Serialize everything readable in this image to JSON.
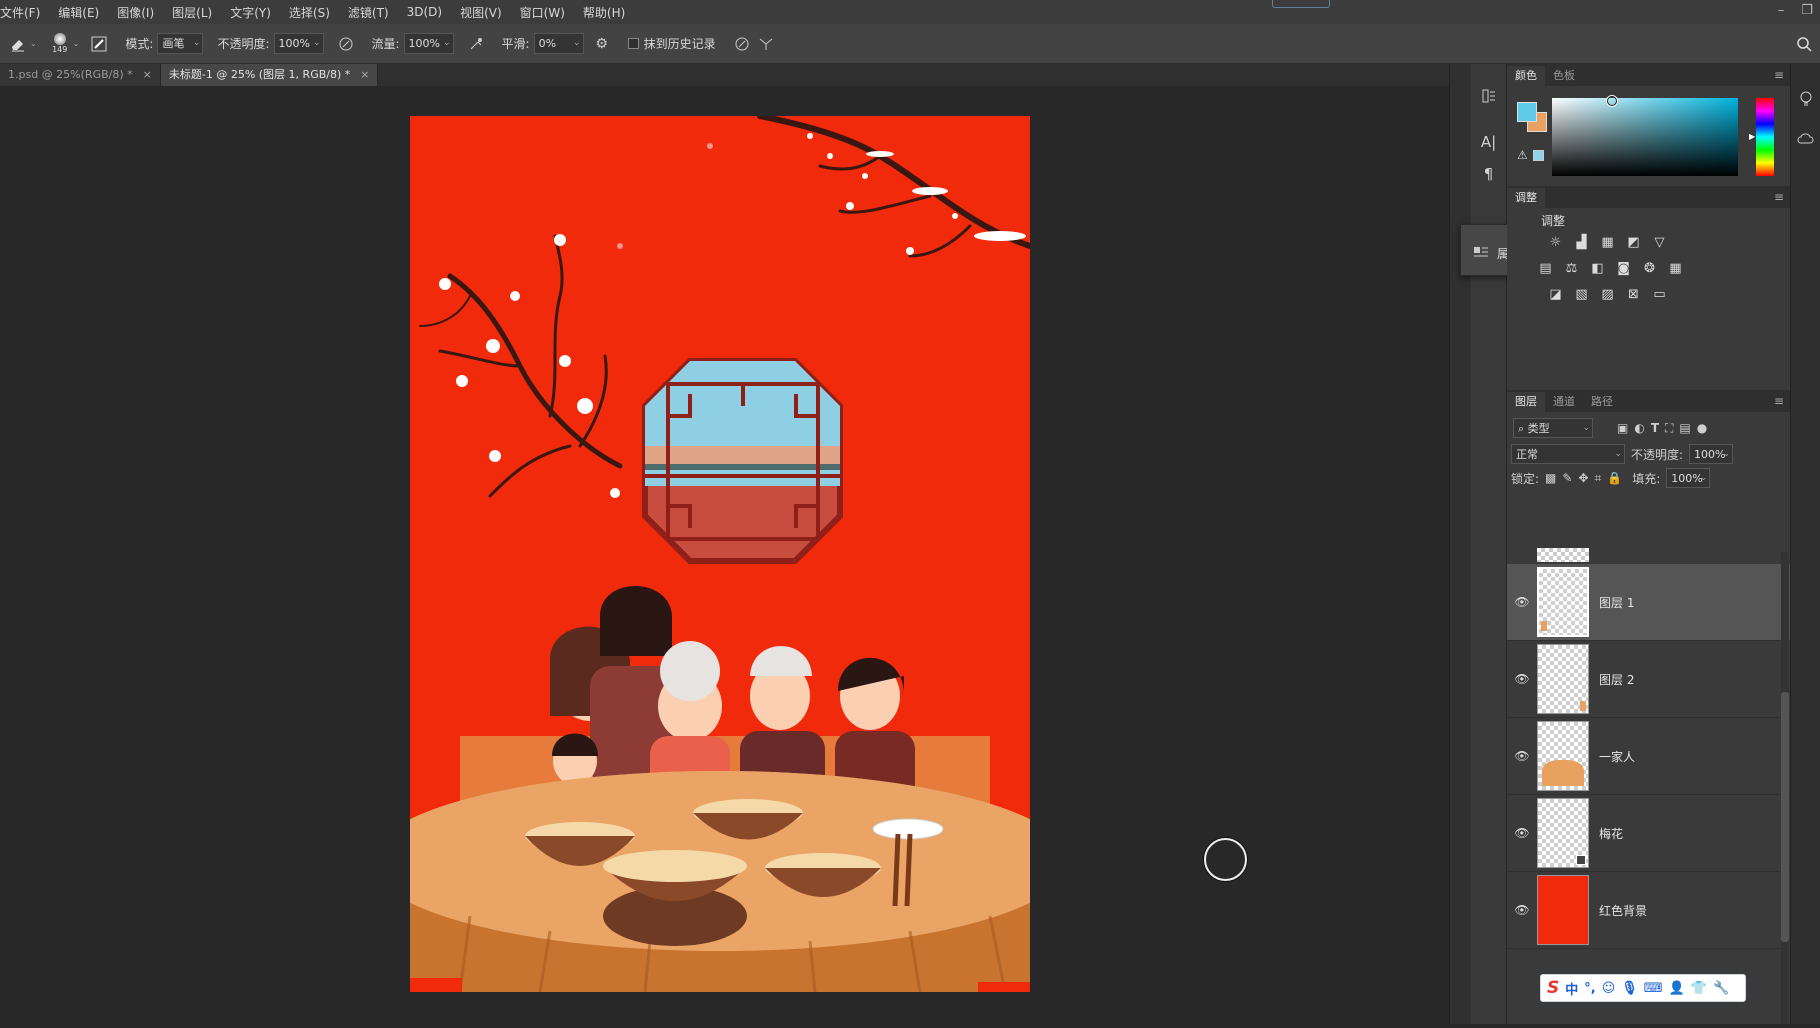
{
  "menu": [
    "文件(F)",
    "编辑(E)",
    "图像(I)",
    "图层(L)",
    "文字(Y)",
    "选择(S)",
    "滤镜(T)",
    "3D(D)",
    "视图(V)",
    "窗口(W)",
    "帮助(H)"
  ],
  "window_buttons": {
    "minimize": "–",
    "restore": "❐"
  },
  "options": {
    "brush_size": "149",
    "mode_label": "模式:",
    "mode_value": "画笔",
    "opacity_label": "不透明度:",
    "opacity_value": "100%",
    "flow_label": "流量:",
    "flow_value": "100%",
    "smooth_label": "平滑:",
    "smooth_value": "0%",
    "erase_history_label": "抹到历史记录"
  },
  "tabs": [
    {
      "label": "1.psd @ 25%(RGB/8) *",
      "close": "×"
    },
    {
      "label": "未标题-1 @ 25% (图层 1, RGB/8) *",
      "close": "×"
    }
  ],
  "flyout": {
    "label": "属性"
  },
  "color_panel": {
    "tabs": [
      "颜色",
      "色板"
    ],
    "fg": "#5fc9e8",
    "bg": "#e8a064"
  },
  "adjust_panel": {
    "tab": "调整",
    "title": "调整"
  },
  "layers_panel": {
    "tabs": [
      "图层",
      "通道",
      "路径"
    ],
    "filter_value": "类型",
    "blend_value": "正常",
    "opacity_label": "不透明度:",
    "opacity_value": "100%",
    "lock_label": "锁定:",
    "fill_label": "填充:",
    "fill_value": "100%",
    "layers": [
      {
        "name": "图层 1",
        "selected": true
      },
      {
        "name": "图层 2",
        "selected": false
      },
      {
        "name": "一家人",
        "selected": false
      },
      {
        "name": "梅花",
        "selected": false
      },
      {
        "name": "红色背景",
        "selected": false
      }
    ]
  },
  "ime": {
    "lang": "中"
  }
}
